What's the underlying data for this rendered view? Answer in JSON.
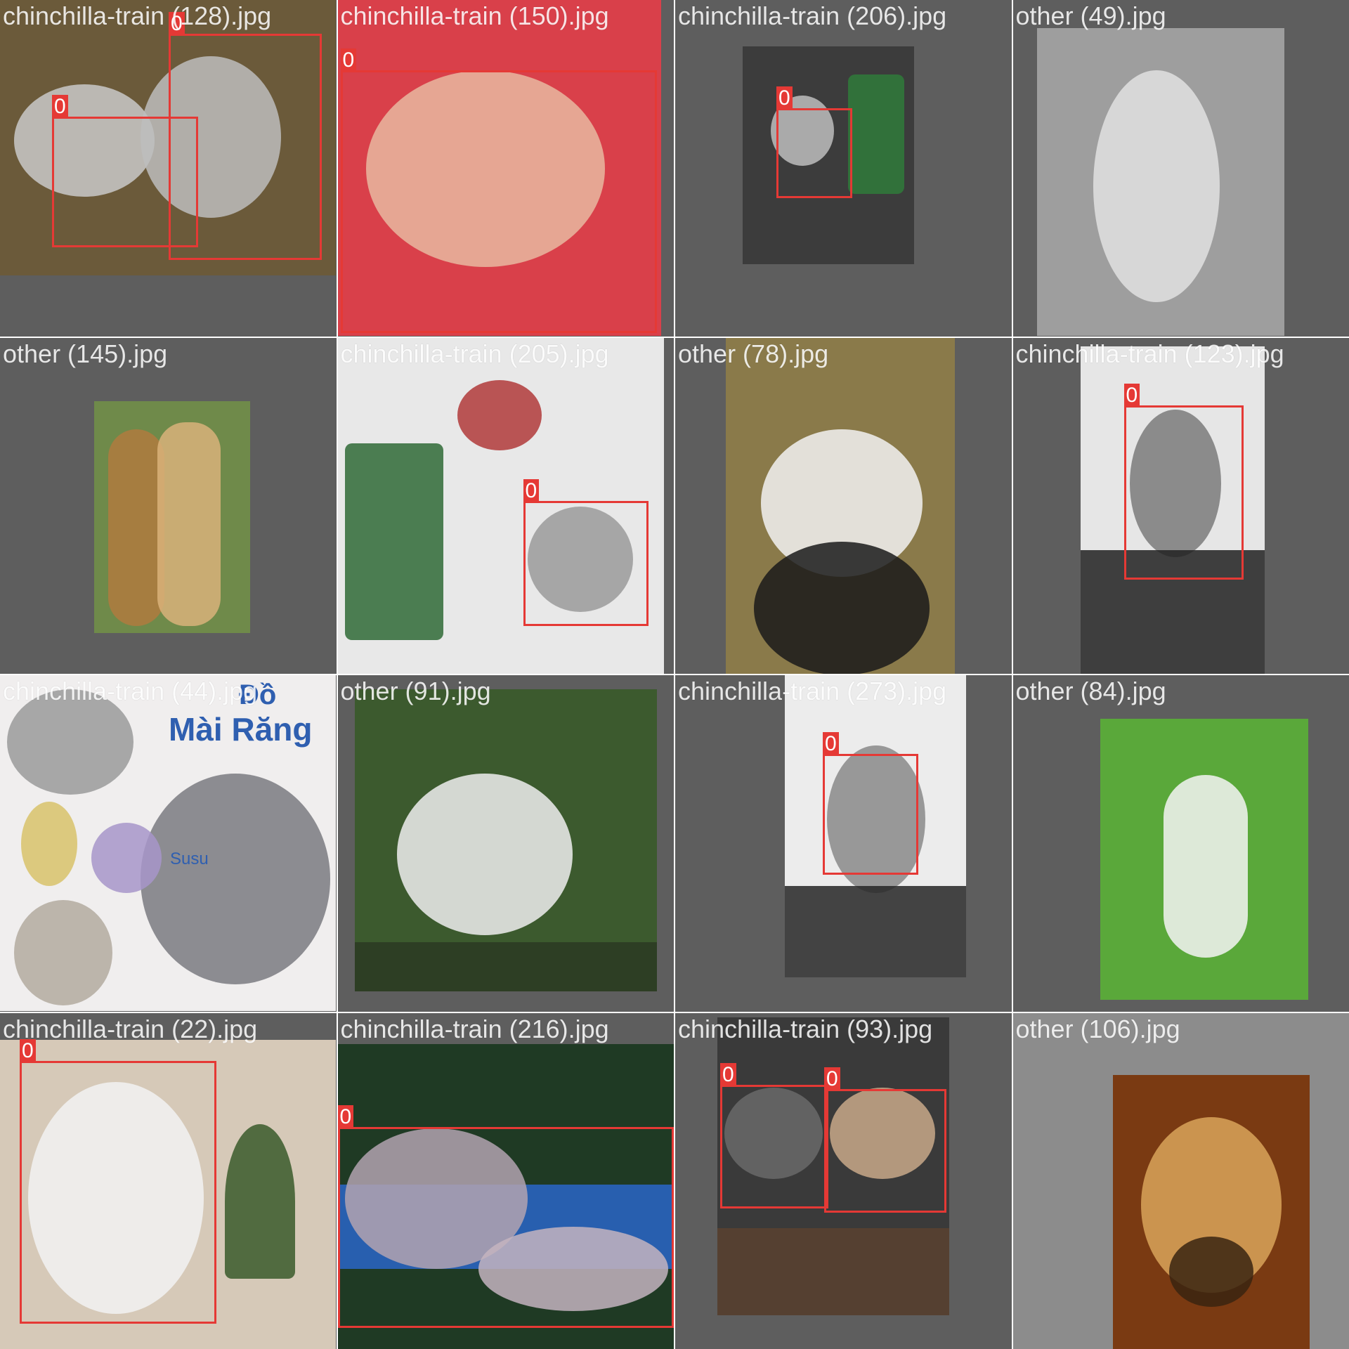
{
  "grid": {
    "tiles": [
      {
        "filename": "chinchilla-train (128).jpg",
        "palette": [
          "#6b5a3a",
          "#c9c9c9",
          "#3a2f22"
        ],
        "boxes": [
          {
            "label": "0"
          },
          {
            "label": "0"
          }
        ]
      },
      {
        "filename": "chinchilla-train (150).jpg",
        "palette": [
          "#d9404a",
          "#e8b9a0",
          "#f2d4c4"
        ],
        "boxes": [
          {
            "label": "0"
          }
        ]
      },
      {
        "filename": "chinchilla-train (206).jpg",
        "palette": [
          "#3c3c3c",
          "#2f7a3a",
          "#bdbdbd"
        ],
        "boxes": [
          {
            "label": "0"
          }
        ]
      },
      {
        "filename": "other (49).jpg",
        "palette": [
          "#9e9e9e",
          "#e0e0e0",
          "#6e6e6e"
        ],
        "boxes": []
      },
      {
        "filename": "other (145).jpg",
        "palette": [
          "#6f8a4a",
          "#b07a3e",
          "#d9b27a"
        ],
        "boxes": []
      },
      {
        "filename": "chinchilla-train (205).jpg",
        "palette": [
          "#e8e8e8",
          "#2f6a36",
          "#b03a3a"
        ],
        "boxes": [
          {
            "label": "0"
          }
        ]
      },
      {
        "filename": "other (78).jpg",
        "palette": [
          "#8a7a4a",
          "#f2f2f2",
          "#1a1a1a"
        ],
        "boxes": []
      },
      {
        "filename": "chinchilla-train (123).jpg",
        "palette": [
          "#e6e6e6",
          "#7a7a7a",
          "#202020"
        ],
        "boxes": [
          {
            "label": "0"
          }
        ]
      },
      {
        "filename": "chinchilla-train (44).jpg",
        "palette": [
          "#f0eeee",
          "#7a7a80",
          "#d8c26a"
        ],
        "boxes": [],
        "poster_text": "Mài Răng",
        "poster_small": "Đồ",
        "poster_signature": "Susu"
      },
      {
        "filename": "other (91).jpg",
        "palette": [
          "#3c5a2e",
          "#efefef",
          "#2a3a22"
        ],
        "boxes": []
      },
      {
        "filename": "chinchilla-train (273).jpg",
        "palette": [
          "#ececec",
          "#8a8a8a",
          "#262626"
        ],
        "boxes": [
          {
            "label": "0"
          }
        ]
      },
      {
        "filename": "other (84).jpg",
        "palette": [
          "#5aa83a",
          "#f5f5f5",
          "#3f8a28"
        ],
        "boxes": []
      },
      {
        "filename": "chinchilla-train (22).jpg",
        "palette": [
          "#d6c9b8",
          "#f2f2f2",
          "#3a5a2a"
        ],
        "boxes": [
          {
            "label": "0"
          }
        ]
      },
      {
        "filename": "chinchilla-train (216).jpg",
        "palette": [
          "#1f3a24",
          "#b3a3b0",
          "#2a66c8"
        ],
        "boxes": [
          {
            "label": "0"
          }
        ]
      },
      {
        "filename": "chinchilla-train (93).jpg",
        "palette": [
          "#3a3a3a",
          "#8a7a6a",
          "#c9a98a"
        ],
        "boxes": [
          {
            "label": "0"
          },
          {
            "label": "0"
          }
        ]
      },
      {
        "filename": "other (106).jpg",
        "palette": [
          "#7a3a12",
          "#d9a45a",
          "#3a2410"
        ],
        "boxes": []
      }
    ]
  }
}
